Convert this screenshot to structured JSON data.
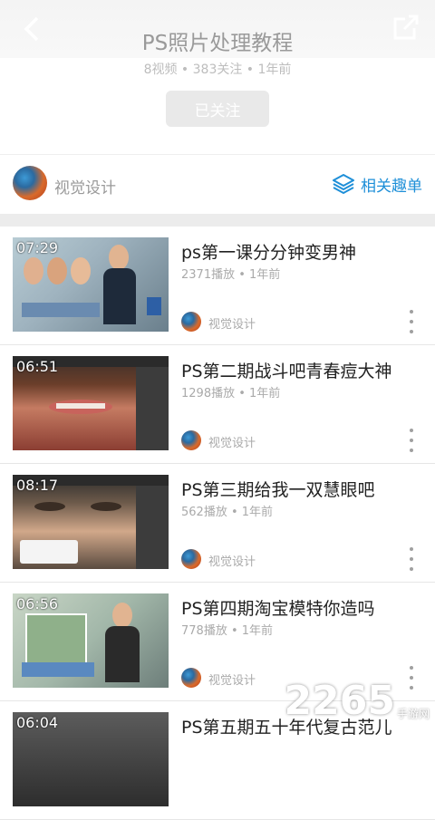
{
  "header": {
    "title": "PS照片处理教程",
    "stats": "8视频 • 383关注 • 1年前",
    "follow_label": "已关注"
  },
  "author": {
    "name": "视觉设计",
    "related_label": "相关趣单"
  },
  "videos": [
    {
      "duration": "07:29",
      "title": "ps第一课分分钟变男神",
      "meta": "2371播放 • 1年前",
      "author": "视觉设计"
    },
    {
      "duration": "06:51",
      "title": "PS第二期战斗吧青春痘大神",
      "meta": "1298播放 • 1年前",
      "author": "视觉设计"
    },
    {
      "duration": "08:17",
      "title": "PS第三期给我一双慧眼吧",
      "meta": "562播放 • 1年前",
      "author": "视觉设计"
    },
    {
      "duration": "06:56",
      "title": "PS第四期淘宝模特你造吗",
      "meta": "778播放 • 1年前",
      "author": "视觉设计"
    },
    {
      "duration": "06:04",
      "title": "PS第五期五十年代复古范儿",
      "meta": "",
      "author": ""
    }
  ],
  "watermark": {
    "big": "2265",
    "small": "手游网"
  },
  "colors": {
    "accent": "#1e8fd8",
    "muted": "#aaaaaa",
    "divider": "#ececec"
  }
}
